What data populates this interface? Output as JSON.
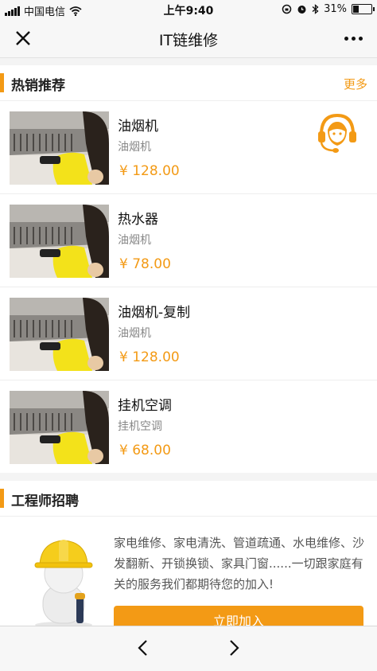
{
  "status_bar": {
    "carrier": "中国电信",
    "time": "上午9:40",
    "battery": "31%",
    "battery_level": 0.31
  },
  "nav": {
    "title": "IT链维修",
    "close_icon": "close-icon",
    "more_icon": "more-icon"
  },
  "hot_section": {
    "title": "热销推荐",
    "more_label": "更多",
    "products": [
      {
        "name": "油烟机",
        "category": "油烟机",
        "price": "¥ 128.00"
      },
      {
        "name": "热水器",
        "category": "油烟机",
        "price": "¥ 78.00"
      },
      {
        "name": "油烟机-复制",
        "category": "油烟机",
        "price": "¥ 128.00"
      },
      {
        "name": "挂机空调",
        "category": "挂机空调",
        "price": "¥ 68.00"
      }
    ]
  },
  "recruit_section": {
    "title": "工程师招聘",
    "description": "家电维修、家电清洗、管道疏通、水电维修、沙发翻新、开锁换锁、家具门窗......一切跟家庭有关的服务我们都期待您的加入!",
    "button_label": "立即加入"
  },
  "toolbar": {
    "back_icon": "chevron-left-icon",
    "forward_icon": "chevron-right-icon"
  },
  "colors": {
    "accent": "#f39a15",
    "background": "#f4f4f4",
    "bar": "#f7f7f7"
  }
}
